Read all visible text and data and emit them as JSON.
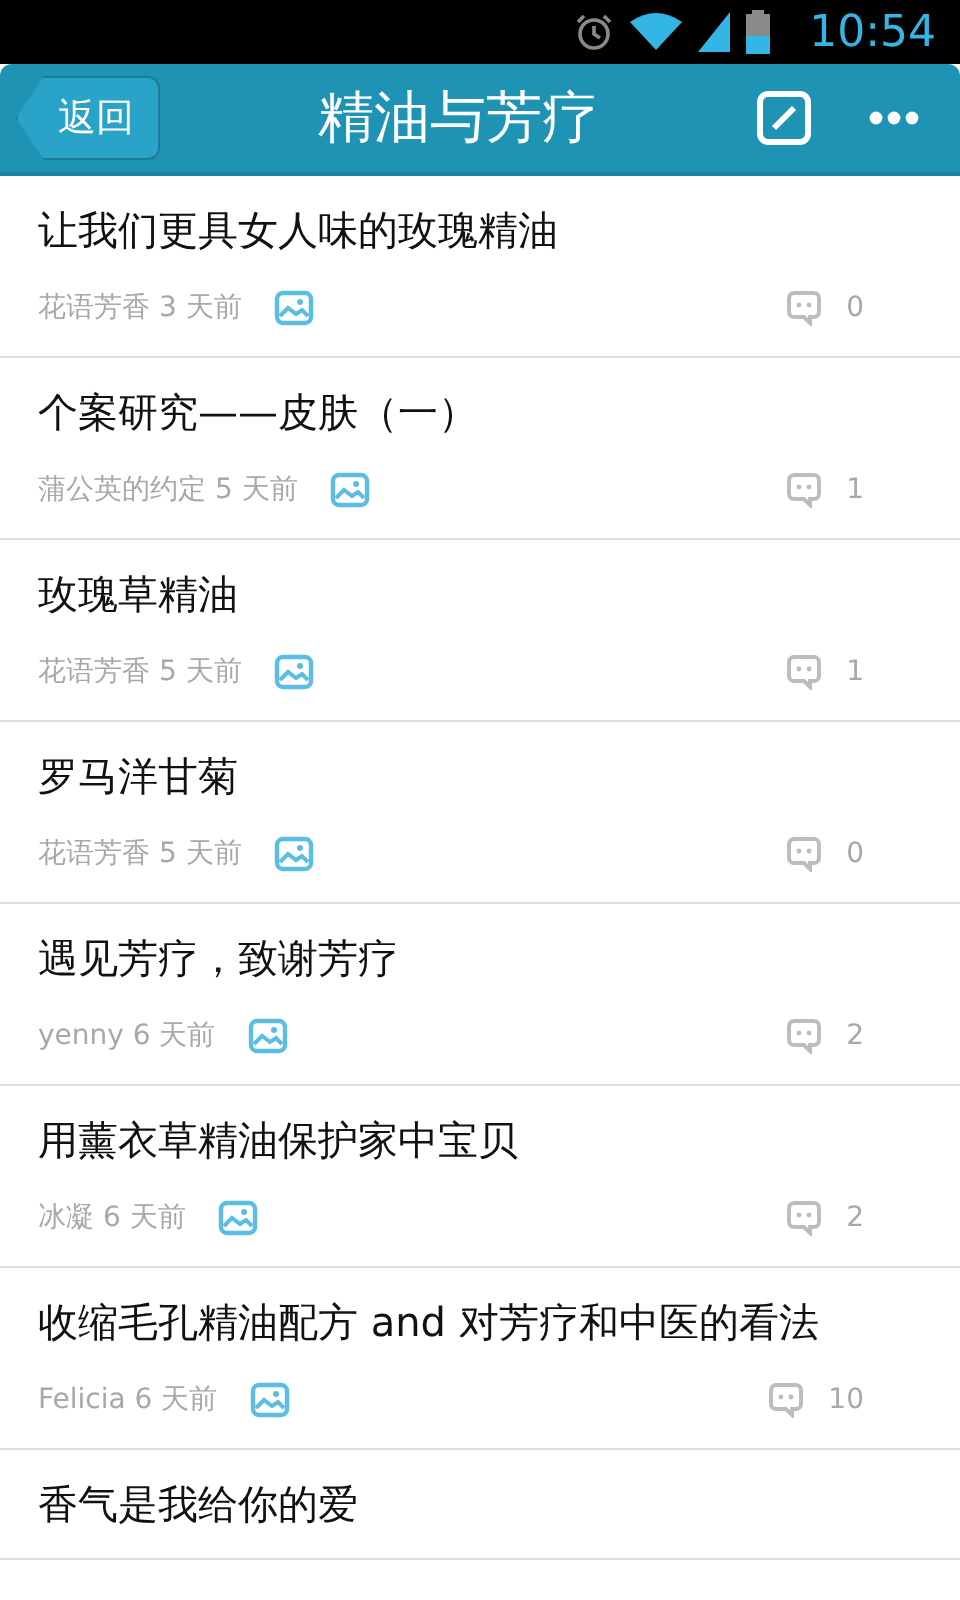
{
  "status_bar": {
    "time": "10:54"
  },
  "header": {
    "back": "返回",
    "title": "精油与芳疗"
  },
  "posts": [
    {
      "title": "让我们更具女人味的玫瑰精油",
      "meta": "花语芳香 3 天前",
      "has_image": true,
      "comments": "0"
    },
    {
      "title": "个案研究——皮肤（一）",
      "meta": "蒲公英的约定 5 天前",
      "has_image": true,
      "comments": "1"
    },
    {
      "title": "玫瑰草精油",
      "meta": "花语芳香 5 天前",
      "has_image": true,
      "comments": "1"
    },
    {
      "title": "罗马洋甘菊",
      "meta": "花语芳香 5 天前",
      "has_image": true,
      "comments": "0"
    },
    {
      "title": "遇见芳疗，致谢芳疗",
      "meta": "yenny 6 天前",
      "has_image": true,
      "comments": "2"
    },
    {
      "title": "用薰衣草精油保护家中宝贝",
      "meta": "冰凝 6 天前",
      "has_image": true,
      "comments": "2"
    },
    {
      "title": "收缩毛孔精油配方 and 对芳疗和中医的看法",
      "meta": "Felicia 6 天前",
      "has_image": true,
      "comments": "10"
    },
    {
      "title": "香气是我给你的爱"
    }
  ]
}
